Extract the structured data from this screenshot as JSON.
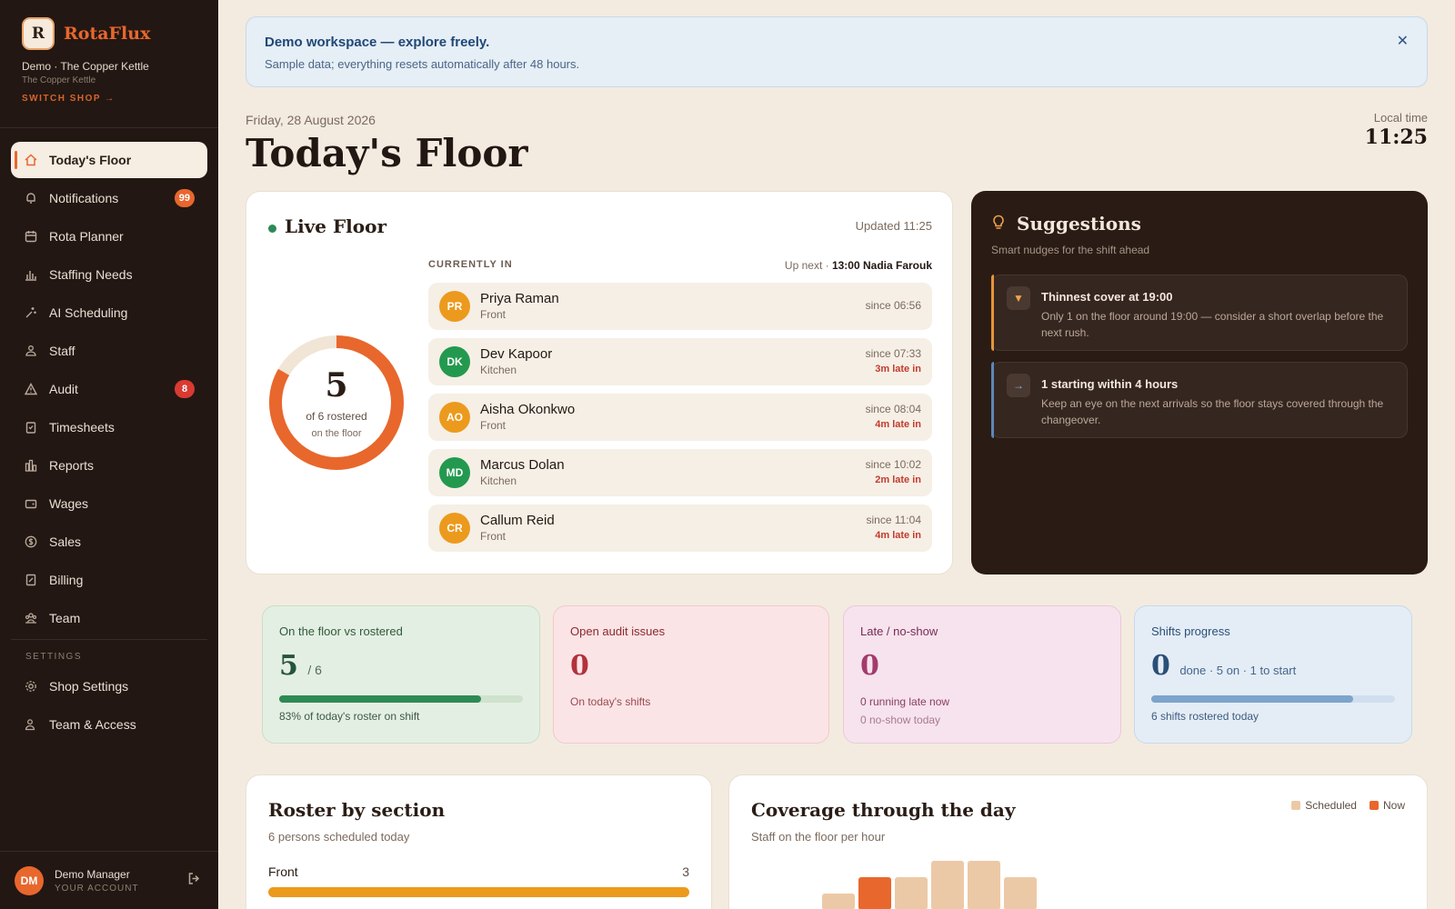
{
  "brand": {
    "logo_letter": "R",
    "name": "RotaFlux"
  },
  "shop": {
    "name": "Demo · The Copper Kettle",
    "sub": "The Copper Kettle",
    "switch": "SWITCH SHOP →"
  },
  "nav": {
    "items": [
      {
        "label": "Today's Floor",
        "icon": "home-icon"
      },
      {
        "label": "Notifications",
        "icon": "bell-icon",
        "badge": "99"
      },
      {
        "label": "Rota Planner",
        "icon": "calendar-icon"
      },
      {
        "label": "Staffing Needs",
        "icon": "bar-chart-icon"
      },
      {
        "label": "AI Scheduling",
        "icon": "sparkle-icon"
      },
      {
        "label": "Staff",
        "icon": "people-icon"
      },
      {
        "label": "Audit",
        "icon": "warning-icon",
        "badge": "8"
      },
      {
        "label": "Timesheets",
        "icon": "clipboard-icon"
      },
      {
        "label": "Reports",
        "icon": "report-icon"
      },
      {
        "label": "Wages",
        "icon": "wallet-icon"
      },
      {
        "label": "Sales",
        "icon": "dollar-icon"
      },
      {
        "label": "Billing",
        "icon": "receipt-icon"
      },
      {
        "label": "Team",
        "icon": "team-icon"
      }
    ],
    "settings_label": "SETTINGS",
    "settings": [
      {
        "label": "Shop Settings",
        "icon": "gear-icon"
      },
      {
        "label": "Team & Access",
        "icon": "user-access-icon"
      }
    ]
  },
  "account": {
    "initials": "DM",
    "name": "Demo Manager",
    "sub": "YOUR ACCOUNT"
  },
  "banner": {
    "title": "Demo workspace — explore freely.",
    "sub": "Sample data; everything resets automatically after 48 hours."
  },
  "header": {
    "date": "Friday, 28 August 2026",
    "title": "Today's Floor",
    "local_label": "Local time",
    "local_time": "11:25"
  },
  "live": {
    "title": "Live Floor",
    "updated": "Updated 11:25",
    "on_floor": "5",
    "of_rostered": "of 6 rostered",
    "on_floor_label": "on the floor",
    "on_floor_count": 5,
    "rostered_count": 6,
    "currently_in_label": "CURRENTLY IN",
    "up_next_prefix": "Up next ·",
    "up_next": "13:00 Nadia Farouk",
    "people": [
      {
        "initials": "PR",
        "name": "Priya Raman",
        "role": "Front",
        "since": "since 06:56",
        "late": "",
        "color": "#ec9a1d"
      },
      {
        "initials": "DK",
        "name": "Dev Kapoor",
        "role": "Kitchen",
        "since": "since 07:33",
        "late": "3m late in",
        "color": "#23994f"
      },
      {
        "initials": "AO",
        "name": "Aisha Okonkwo",
        "role": "Front",
        "since": "since 08:04",
        "late": "4m late in",
        "color": "#ec9a1d"
      },
      {
        "initials": "MD",
        "name": "Marcus Dolan",
        "role": "Kitchen",
        "since": "since 10:02",
        "late": "2m late in",
        "color": "#23994f"
      },
      {
        "initials": "CR",
        "name": "Callum Reid",
        "role": "Front",
        "since": "since 11:04",
        "late": "4m late in",
        "color": "#ec9a1d"
      }
    ]
  },
  "suggestions": {
    "title": "Suggestions",
    "sub": "Smart nudges for the shift ahead",
    "items": [
      {
        "title": "Thinnest cover at 19:00",
        "desc": "Only 1 on the floor around 19:00 — consider a short overlap before the next rush.",
        "icon": "down-triangle-icon",
        "glyph": "▼",
        "accent": "#e8943a"
      },
      {
        "title": "1 starting within 4 hours",
        "desc": "Keep an eye on the next arrivals so the floor stays covered through the changeover.",
        "icon": "arrow-right-icon",
        "glyph": "→",
        "accent": "#5b88b8"
      }
    ]
  },
  "kpis": [
    {
      "label": "On the floor vs rostered",
      "value": "5",
      "suffix": "/ 6",
      "progress": 0.83,
      "note1": "83% of today's roster on shift",
      "note2": ""
    },
    {
      "label": "Open audit issues",
      "value": "0",
      "suffix": "",
      "progress": null,
      "note1": "On today's shifts",
      "note2": ""
    },
    {
      "label": "Late / no-show",
      "value": "0",
      "suffix": "",
      "progress": null,
      "note1": "0 running late now",
      "note2": "0 no-show today"
    },
    {
      "label": "Shifts progress",
      "value": "0",
      "suffix": "done · 5 on · 1 to start",
      "progress": 0.83,
      "note1": "6 shifts rostered today",
      "note2": ""
    }
  ],
  "roster": {
    "title": "Roster by section",
    "sub": "6 persons scheduled today",
    "sections": [
      {
        "name": "Front",
        "value": "3"
      }
    ]
  },
  "coverage": {
    "title": "Coverage through the day",
    "sub": "Staff on the floor per hour",
    "legend_scheduled": "Scheduled",
    "legend_now": "Now"
  },
  "colors": {
    "accent": "#e8672d",
    "sidebar": "#231713",
    "scheduled": "#ecc9a6",
    "now": "#e8672d"
  },
  "chart_data": {
    "type": "bar",
    "title": "Coverage through the day",
    "series": [
      {
        "name": "Scheduled",
        "values": [
          1,
          2,
          2,
          3,
          3,
          2
        ]
      }
    ],
    "highlight_index": 1,
    "legend": [
      "Scheduled",
      "Now"
    ]
  }
}
